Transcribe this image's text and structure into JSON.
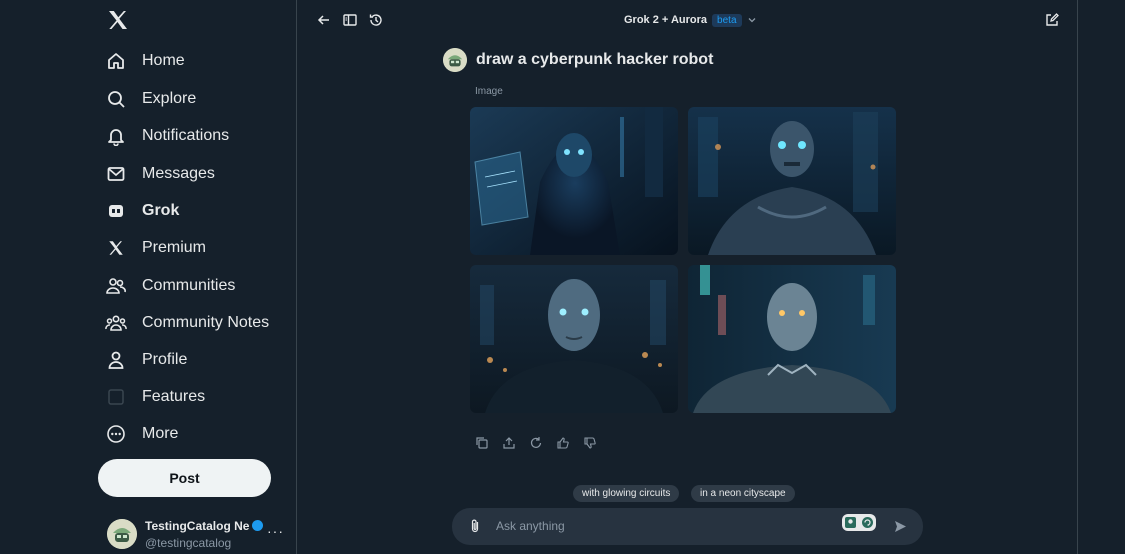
{
  "sidebar": {
    "logo_icon": "x-logo-icon",
    "items": [
      {
        "label": "Home",
        "icon": "home-icon"
      },
      {
        "label": "Explore",
        "icon": "search-icon"
      },
      {
        "label": "Notifications",
        "icon": "bell-icon"
      },
      {
        "label": "Messages",
        "icon": "mail-icon"
      },
      {
        "label": "Grok",
        "icon": "grok-icon",
        "active": true
      },
      {
        "label": "Premium",
        "icon": "x-icon"
      },
      {
        "label": "Communities",
        "icon": "communities-icon"
      },
      {
        "label": "Community Notes",
        "icon": "community-notes-icon"
      },
      {
        "label": "Profile",
        "icon": "profile-icon"
      },
      {
        "label": "Features",
        "icon": "checkbox-icon"
      },
      {
        "label": "More",
        "icon": "more-circle-icon"
      }
    ],
    "post_label": "Post",
    "account": {
      "name": "TestingCatalog Ne",
      "handle": "@testingcatalog",
      "more": "···"
    }
  },
  "header": {
    "model": "Grok 2 + Aurora",
    "badge": "beta"
  },
  "conversation": {
    "prompt": "draw a cyberpunk hacker robot",
    "result_label": "Image",
    "images": [
      {
        "subject": "hooded robot holding tablet"
      },
      {
        "subject": "robot in city street"
      },
      {
        "subject": "android in neon city night"
      },
      {
        "subject": "android with glowing circuits"
      }
    ]
  },
  "suggestions": [
    "with glowing circuits",
    "in a neon cityscape"
  ],
  "composer": {
    "placeholder": "Ask anything"
  },
  "colors": {
    "background": "#15202b",
    "accent": "#1d9bf0",
    "post_button": "#eff3f4"
  }
}
